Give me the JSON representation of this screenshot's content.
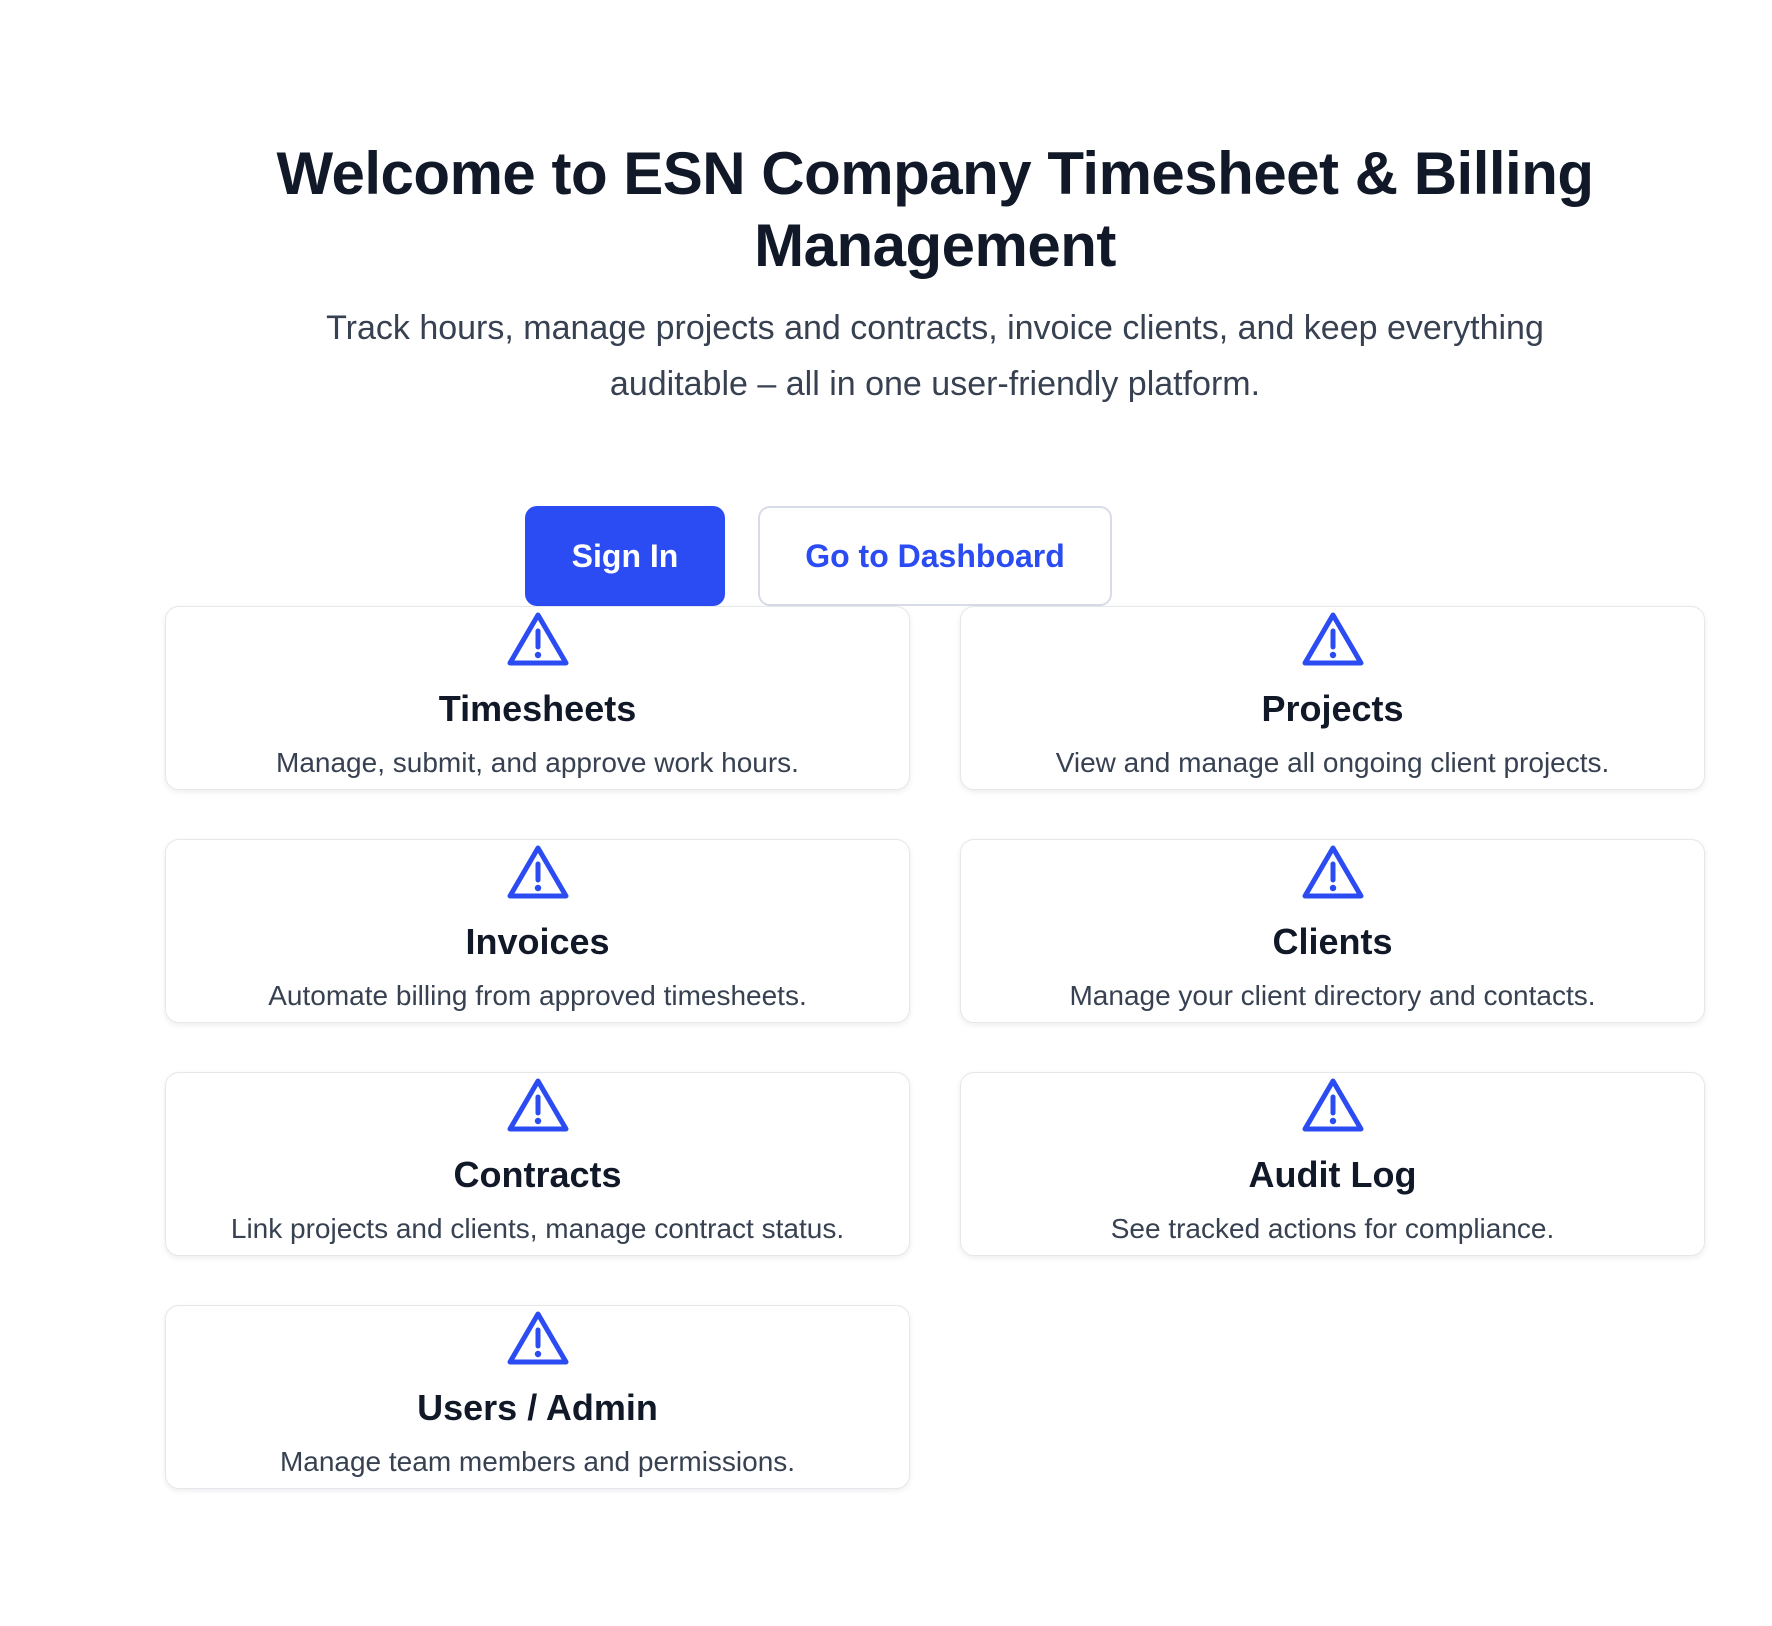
{
  "hero": {
    "title": "Welcome to ESN Company Timesheet & Billing Management",
    "subtitle": "Track hours, manage projects and contracts, invoice clients, and keep everything auditable – all in one user-friendly platform."
  },
  "actions": {
    "sign_in_label": "Sign In",
    "dashboard_label": "Go to Dashboard"
  },
  "colors": {
    "accent": "#2b4cf3",
    "heading": "#111827",
    "body_text": "#374151",
    "card_border": "#e5e7eb"
  },
  "features": [
    {
      "icon": "warning-icon",
      "title": "Timesheets",
      "description": "Manage, submit, and approve work hours."
    },
    {
      "icon": "warning-icon",
      "title": "Projects",
      "description": "View and manage all ongoing client projects."
    },
    {
      "icon": "warning-icon",
      "title": "Invoices",
      "description": "Automate billing from approved timesheets."
    },
    {
      "icon": "warning-icon",
      "title": "Clients",
      "description": "Manage your client directory and contacts."
    },
    {
      "icon": "warning-icon",
      "title": "Contracts",
      "description": "Link projects and clients, manage contract status."
    },
    {
      "icon": "warning-icon",
      "title": "Audit Log",
      "description": "See tracked actions for compliance."
    },
    {
      "icon": "warning-icon",
      "title": "Users / Admin",
      "description": "Manage team members and permissions."
    }
  ]
}
